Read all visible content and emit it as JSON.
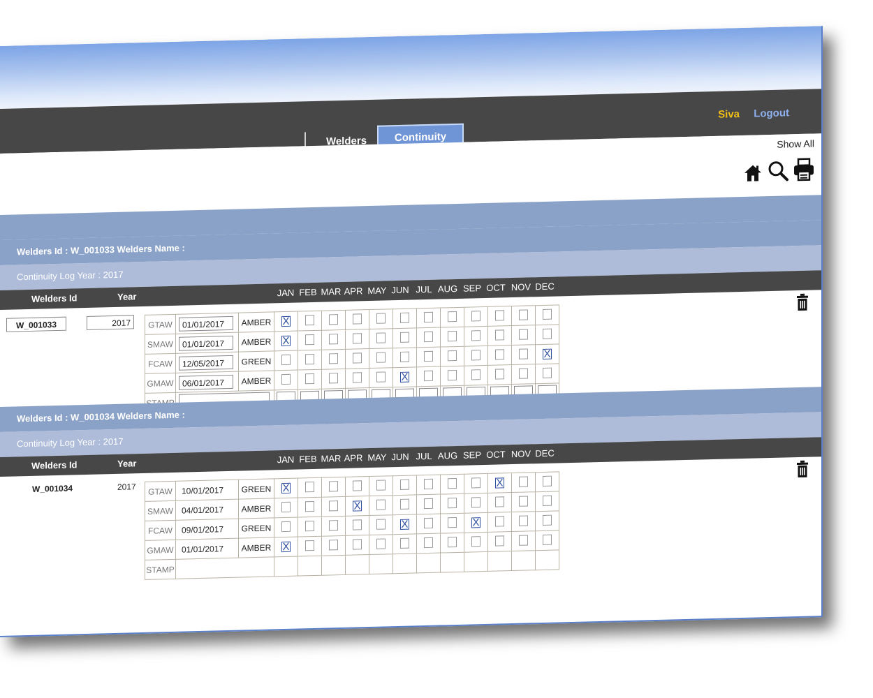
{
  "header": {
    "nav_tabs": [
      {
        "label": "Welders",
        "active": false
      },
      {
        "label": "Continuity Log",
        "active": true
      }
    ],
    "user": "Siva",
    "logout_label": "Logout"
  },
  "toolbar": {
    "show_all_label": "Show All",
    "icons": [
      "home-icon",
      "search-icon",
      "print-icon"
    ]
  },
  "columns": {
    "welders_id": "Welders Id",
    "year": "Year",
    "months": [
      "JAN",
      "FEB",
      "MAR",
      "APR",
      "MAY",
      "JUN",
      "JUL",
      "AUG",
      "SEP",
      "OCT",
      "NOV",
      "DEC"
    ]
  },
  "records": [
    {
      "header": "Welders Id : W_001033   Welders Name :",
      "log_year": "Continuity Log Year : 2017",
      "welder_id": "W_001033",
      "year": "2017",
      "editable": true,
      "rows": [
        {
          "process": "GTAW",
          "date": "01/01/2017",
          "status": "AMBER",
          "checked": [
            0
          ]
        },
        {
          "process": "SMAW",
          "date": "01/01/2017",
          "status": "AMBER",
          "checked": [
            0
          ]
        },
        {
          "process": "FCAW",
          "date": "12/05/2017",
          "status": "GREEN",
          "checked": [
            11
          ]
        },
        {
          "process": "GMAW",
          "date": "06/01/2017",
          "status": "AMBER",
          "checked": [
            5
          ]
        }
      ],
      "stamp_label": "STAMP"
    },
    {
      "header": "Welders Id : W_001034   Welders Name :",
      "log_year": "Continuity Log Year : 2017",
      "welder_id": "W_001034",
      "year": "2017",
      "editable": false,
      "rows": [
        {
          "process": "GTAW",
          "date": "10/01/2017",
          "status": "GREEN",
          "checked": [
            0,
            9
          ]
        },
        {
          "process": "SMAW",
          "date": "04/01/2017",
          "status": "AMBER",
          "checked": [
            3
          ]
        },
        {
          "process": "FCAW",
          "date": "09/01/2017",
          "status": "GREEN",
          "checked": [
            5,
            8
          ]
        },
        {
          "process": "GMAW",
          "date": "01/01/2017",
          "status": "AMBER",
          "checked": [
            0
          ]
        }
      ],
      "stamp_label": "STAMP"
    }
  ],
  "check_mark": "X",
  "colors": {
    "nav_bg": "#474747",
    "active_tab": "#6f95d7",
    "user_name": "#f3c015",
    "logout": "#8fb0ee",
    "section_bar": "#8ba2c8",
    "subsection_bar": "#aebcd9",
    "check": "#2e4fa0"
  }
}
